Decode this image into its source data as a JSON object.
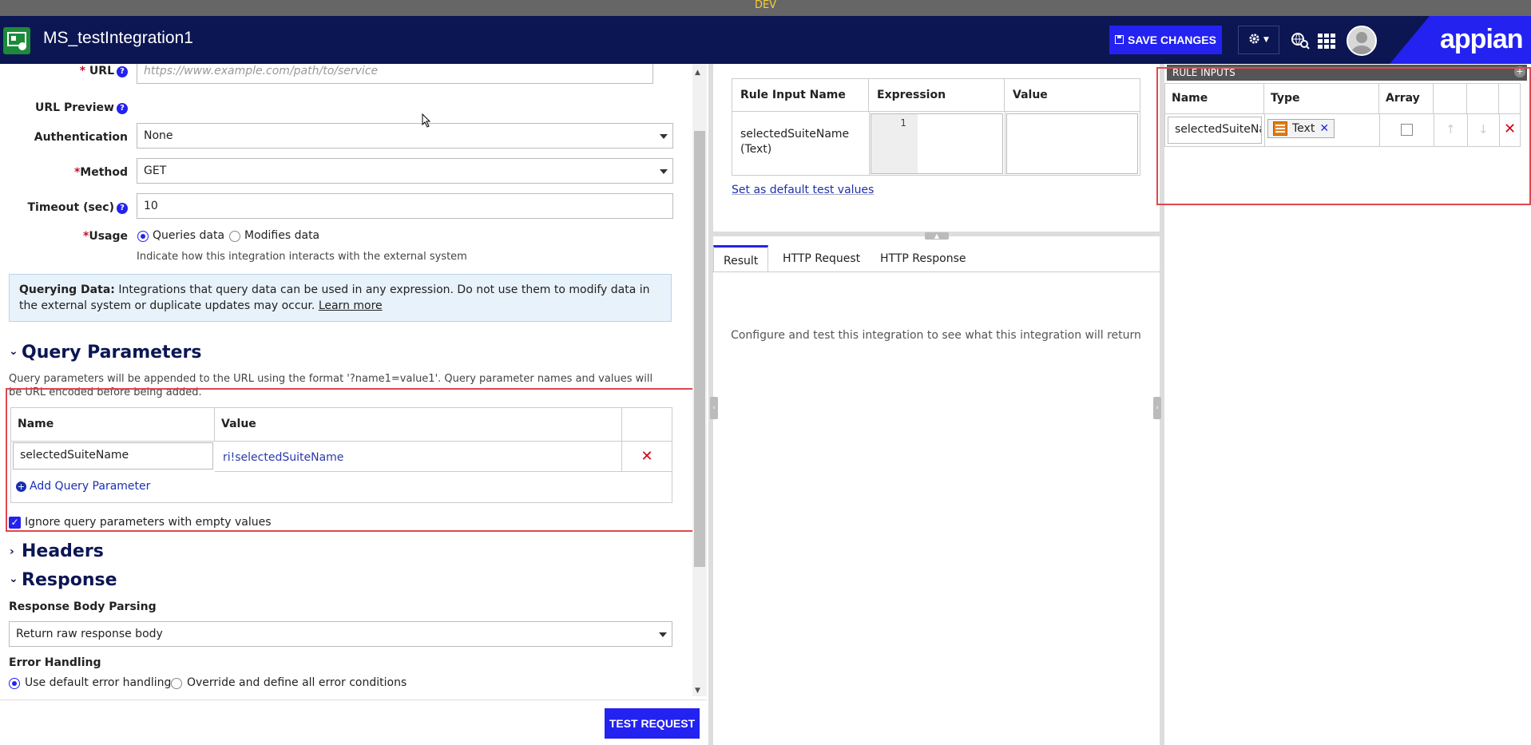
{
  "env_banner": "DEV",
  "header": {
    "title": "MS_testIntegration1",
    "save_label": "SAVE CHANGES",
    "brand": "appian"
  },
  "form": {
    "url_label": "URL",
    "url_placeholder": "https://www.example.com/path/to/service",
    "url_preview_label": "URL Preview",
    "auth_label": "Authentication",
    "auth_value": "None",
    "method_label": "Method",
    "method_value": "GET",
    "timeout_label": "Timeout (sec)",
    "timeout_value": "10",
    "usage_label": "Usage",
    "usage_opt1": "Queries data",
    "usage_opt2": "Modifies data",
    "usage_hint": "Indicate how this integration interacts with the external system",
    "info_bold": "Querying Data:",
    "info_text": " Integrations that query data can be used in any expression. Do not use them to modify data in the external system or duplicate updates may occur. ",
    "info_link": "Learn more"
  },
  "query_params": {
    "title": "Query Parameters",
    "desc": "Query parameters will be appended to the URL using the format '?name1=value1'. Query parameter names and values will be URL encoded before being added.",
    "col_name": "Name",
    "col_value": "Value",
    "rows": [
      {
        "name": "selectedSuiteName",
        "value": "ri!selectedSuiteName"
      }
    ],
    "add_label": "Add Query Parameter",
    "ignore_label": "Ignore query parameters with empty values"
  },
  "headers_section": {
    "title": "Headers"
  },
  "response": {
    "title": "Response",
    "parsing_label": "Response Body Parsing",
    "parsing_value": "Return raw response body",
    "error_label": "Error Handling",
    "error_opt1": "Use default error handling",
    "error_opt2": "Override and define all error conditions"
  },
  "test_button": "TEST REQUEST",
  "test_inputs": {
    "col_name": "Rule Input Name",
    "col_expr": "Expression",
    "col_value": "Value",
    "row_name_line1": "selectedSuiteName",
    "row_name_line2": "(Text)",
    "line_number": "1",
    "default_link": "Set as default test values"
  },
  "result_tabs": [
    "Result",
    "HTTP Request",
    "HTTP Response"
  ],
  "result_message": "Configure and test this integration to see what this integration will return",
  "rule_inputs": {
    "header": "RULE INPUTS",
    "col_name": "Name",
    "col_type": "Type",
    "col_array": "Array",
    "row_name": "selectedSuiteNa",
    "row_type": "Text"
  },
  "colors": {
    "navy": "#0b1653",
    "accent": "#2322f0",
    "highlight": "#e0474f"
  }
}
